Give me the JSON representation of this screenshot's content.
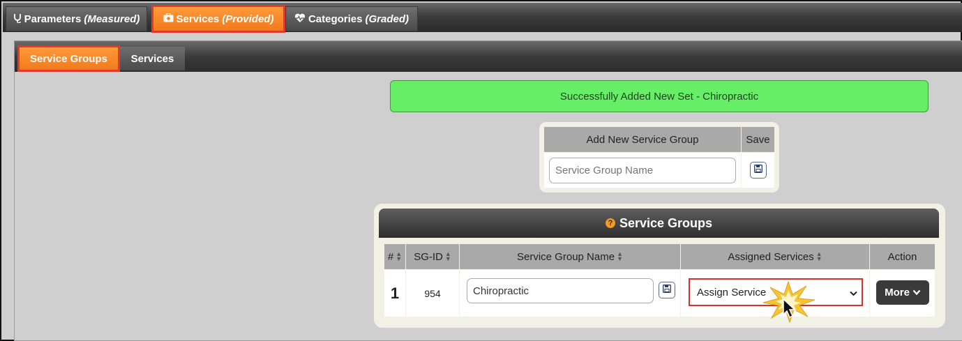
{
  "top_tabs": [
    {
      "label": "Parameters",
      "qualifier": "(Measured)",
      "icon": "stethoscope-icon",
      "active": false
    },
    {
      "label": "Services",
      "qualifier": "(Provided)",
      "icon": "medical-kit-icon",
      "active": true
    },
    {
      "label": "Categories",
      "qualifier": "(Graded)",
      "icon": "heart-pulse-icon",
      "active": false
    }
  ],
  "sub_tabs": [
    {
      "label": "Service Groups",
      "active": true
    },
    {
      "label": "Services",
      "active": false
    }
  ],
  "alert": {
    "message": "Successfully Added New Set - Chiropractic",
    "color": "#66ee66"
  },
  "add_group": {
    "header_name": "Add New Service Group",
    "header_save": "Save",
    "name_placeholder": "Service Group Name",
    "save_icon": "floppy-disk-icon"
  },
  "service_groups": {
    "title": "Service Groups",
    "help_icon": "question-circle-icon",
    "columns": [
      "#",
      "SG-ID",
      "Service Group Name",
      "Assigned Services",
      "Action"
    ],
    "rows": [
      {
        "num": "1",
        "sg_id": "954",
        "name": "Chiropractic",
        "assigned": "Assign Service",
        "action": "More"
      }
    ]
  },
  "colors": {
    "accent": "#f27a1a",
    "highlight": "#e03a2e",
    "header": "#a9a9a9"
  }
}
